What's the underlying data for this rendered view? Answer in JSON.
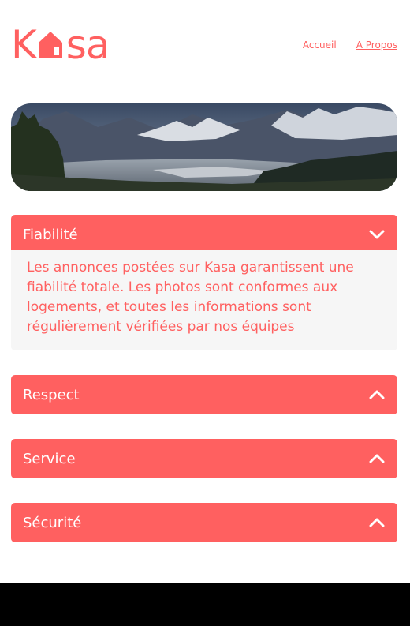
{
  "brand": {
    "logo_letter_1": "K",
    "logo_letters_2": "sa",
    "color": "#FF6060"
  },
  "nav": {
    "items": [
      "Accueil",
      "A Propos"
    ],
    "active": "A Propos"
  },
  "banner": {
    "alt": "mountains-landscape"
  },
  "sections": [
    {
      "title": "Fiabilité",
      "expanded": true,
      "icon": "chevron-down-icon",
      "text": "Les annonces postées sur Kasa garantissent une fiabilité totale. Les photos sont conformes aux logements, et toutes les informations sont régulièrement vérifiées par nos équipes"
    },
    {
      "title": "Respect",
      "expanded": false,
      "icon": "chevron-up-icon"
    },
    {
      "title": "Service",
      "expanded": false,
      "icon": "chevron-up-icon"
    },
    {
      "title": "Sécurité",
      "expanded": false,
      "icon": "chevron-up-icon"
    }
  ],
  "colors": {
    "accent": "#FF6060",
    "panel": "#F6F6F6",
    "footer": "#000000"
  }
}
